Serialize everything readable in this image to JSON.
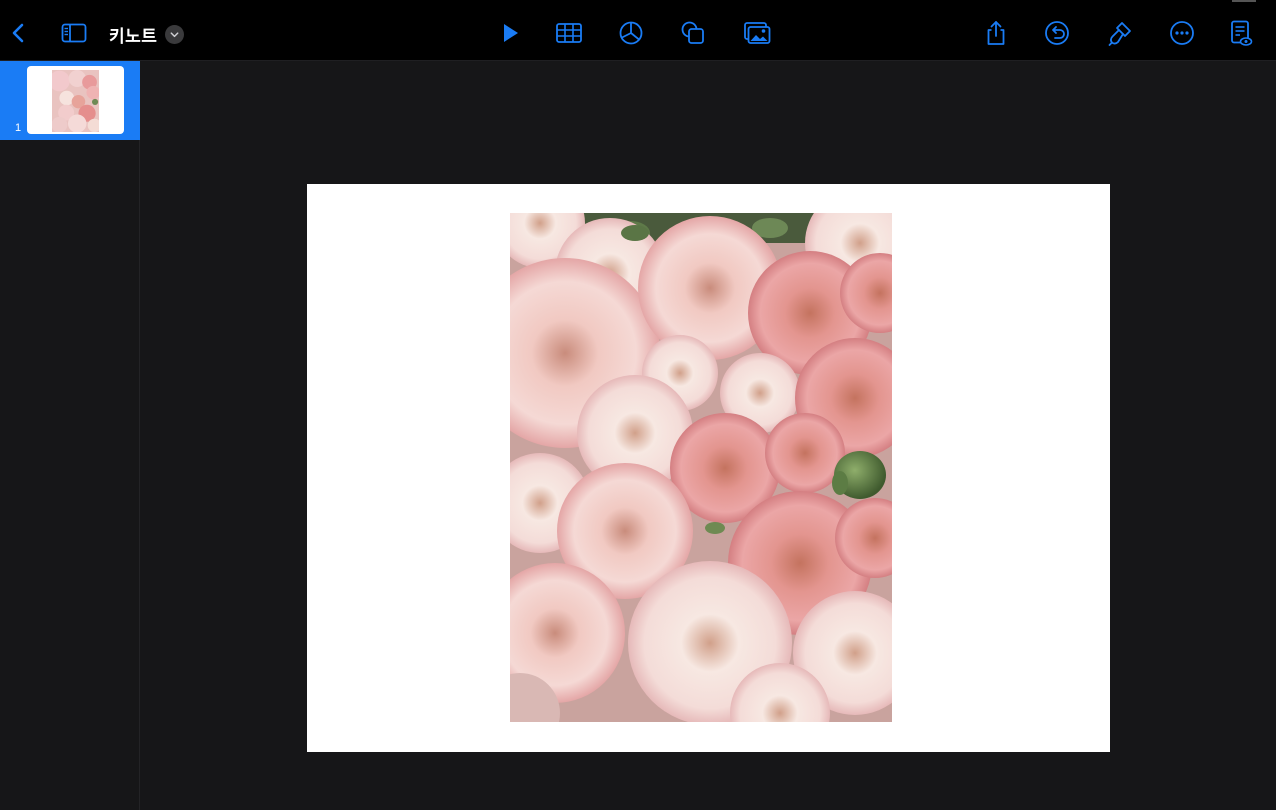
{
  "toolbar": {
    "back_icon": "chevron-left-icon",
    "sidebar_icon": "sidebar-toggle-icon",
    "document_title": "키노트",
    "title_menu_icon": "chevron-down-icon",
    "center_tools": [
      "play-icon",
      "table-icon",
      "chart-icon",
      "shapes-icon",
      "media-icon"
    ],
    "right_tools": [
      "share-icon",
      "undo-icon",
      "format-brush-icon",
      "more-icon",
      "presenter-notes-icon"
    ]
  },
  "navigator": {
    "slides": [
      {
        "number": "1",
        "selected": true
      }
    ]
  },
  "slide": {
    "background": "#ffffff",
    "image": "pink-ranunculus-flowers-photo"
  },
  "colors": {
    "accent": "#1a7cf5",
    "toolbar_bg": "#000000",
    "canvas_bg": "#161618"
  }
}
